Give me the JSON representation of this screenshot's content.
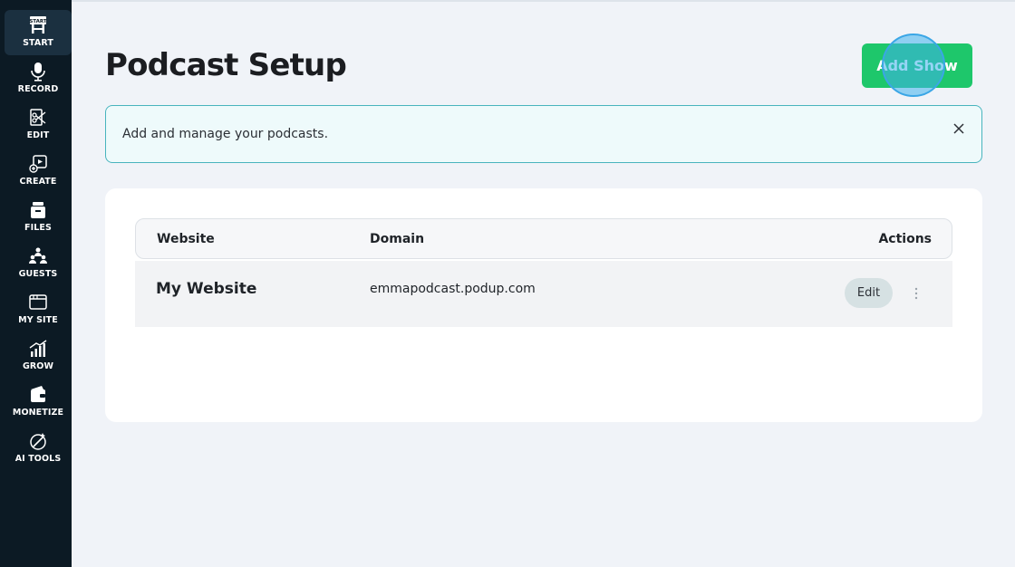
{
  "sidebar": {
    "items": [
      {
        "label": "START",
        "icon": "start-icon",
        "active": true
      },
      {
        "label": "RECORD",
        "icon": "microphone-icon"
      },
      {
        "label": "EDIT",
        "icon": "edit-icon"
      },
      {
        "label": "CREATE",
        "icon": "create-icon"
      },
      {
        "label": "FILES",
        "icon": "files-icon"
      },
      {
        "label": "GUESTS",
        "icon": "guests-icon"
      },
      {
        "label": "MY SITE",
        "icon": "my-site-icon"
      },
      {
        "label": "GROW",
        "icon": "grow-icon"
      },
      {
        "label": "MONETIZE",
        "icon": "monetize-icon"
      },
      {
        "label": "AI TOOLS",
        "icon": "ai-tools-icon"
      }
    ],
    "start_badge": "START"
  },
  "header": {
    "title": "Podcast Setup",
    "add_button_label": "Add Show"
  },
  "banner": {
    "text": "Add and manage your podcasts.",
    "close_icon": "close-icon"
  },
  "table": {
    "columns": [
      "Website",
      "Domain",
      "Actions"
    ],
    "rows": [
      {
        "website": "My Website",
        "domain": "emmapodcast.podup.com",
        "edit_label": "Edit",
        "more_icon": "more-vertical-icon"
      }
    ]
  },
  "colors": {
    "sidebar_bg": "#0c1a24",
    "page_bg": "#f0f3f8",
    "accent_green": "#1ec76b",
    "banner_border": "#48b4be",
    "click_marker": "#3aa6e6"
  }
}
